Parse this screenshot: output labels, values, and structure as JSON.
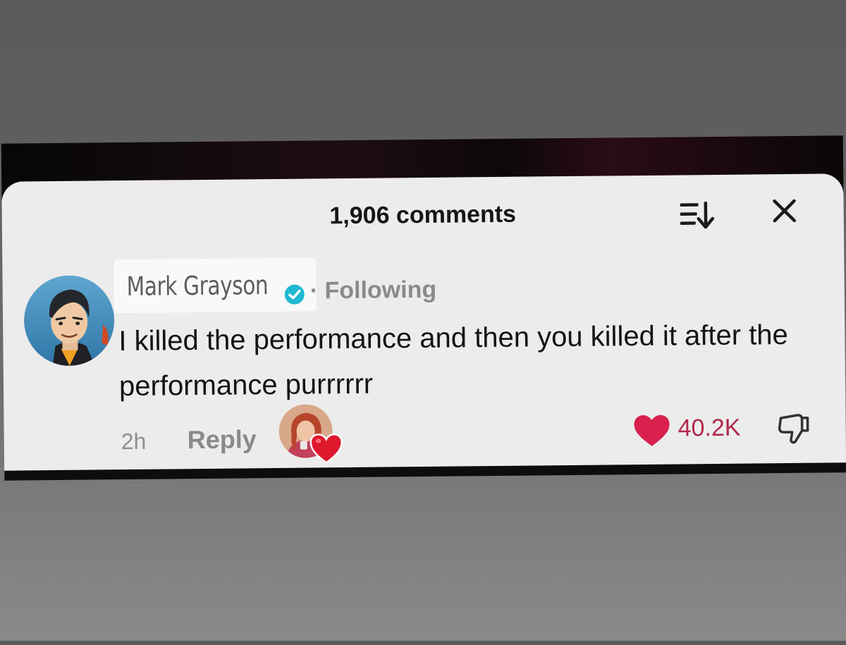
{
  "header": {
    "comments_count": "1,906 comments"
  },
  "comment": {
    "username": "Mark Grayson",
    "separator": "·",
    "following_label": "Following",
    "text": "I killed the performance and then you killed it after the performance purrrrrr",
    "time": "2h",
    "reply_label": "Reply",
    "like_count": "40.2K",
    "liked": true,
    "liked_by_creator": true
  },
  "colors": {
    "panel_background": "#ececec",
    "like_heart": "#d9214e",
    "like_count": "#b0284a",
    "verified_badge": "#20b9d2",
    "muted_text": "#8a8a8a"
  },
  "icons": {
    "sort": "sort-icon",
    "close": "close-icon",
    "verified": "verified-badge-icon",
    "like": "heart-icon",
    "dislike": "thumbs-down-icon",
    "creator_heart": "red-heart-icon"
  }
}
